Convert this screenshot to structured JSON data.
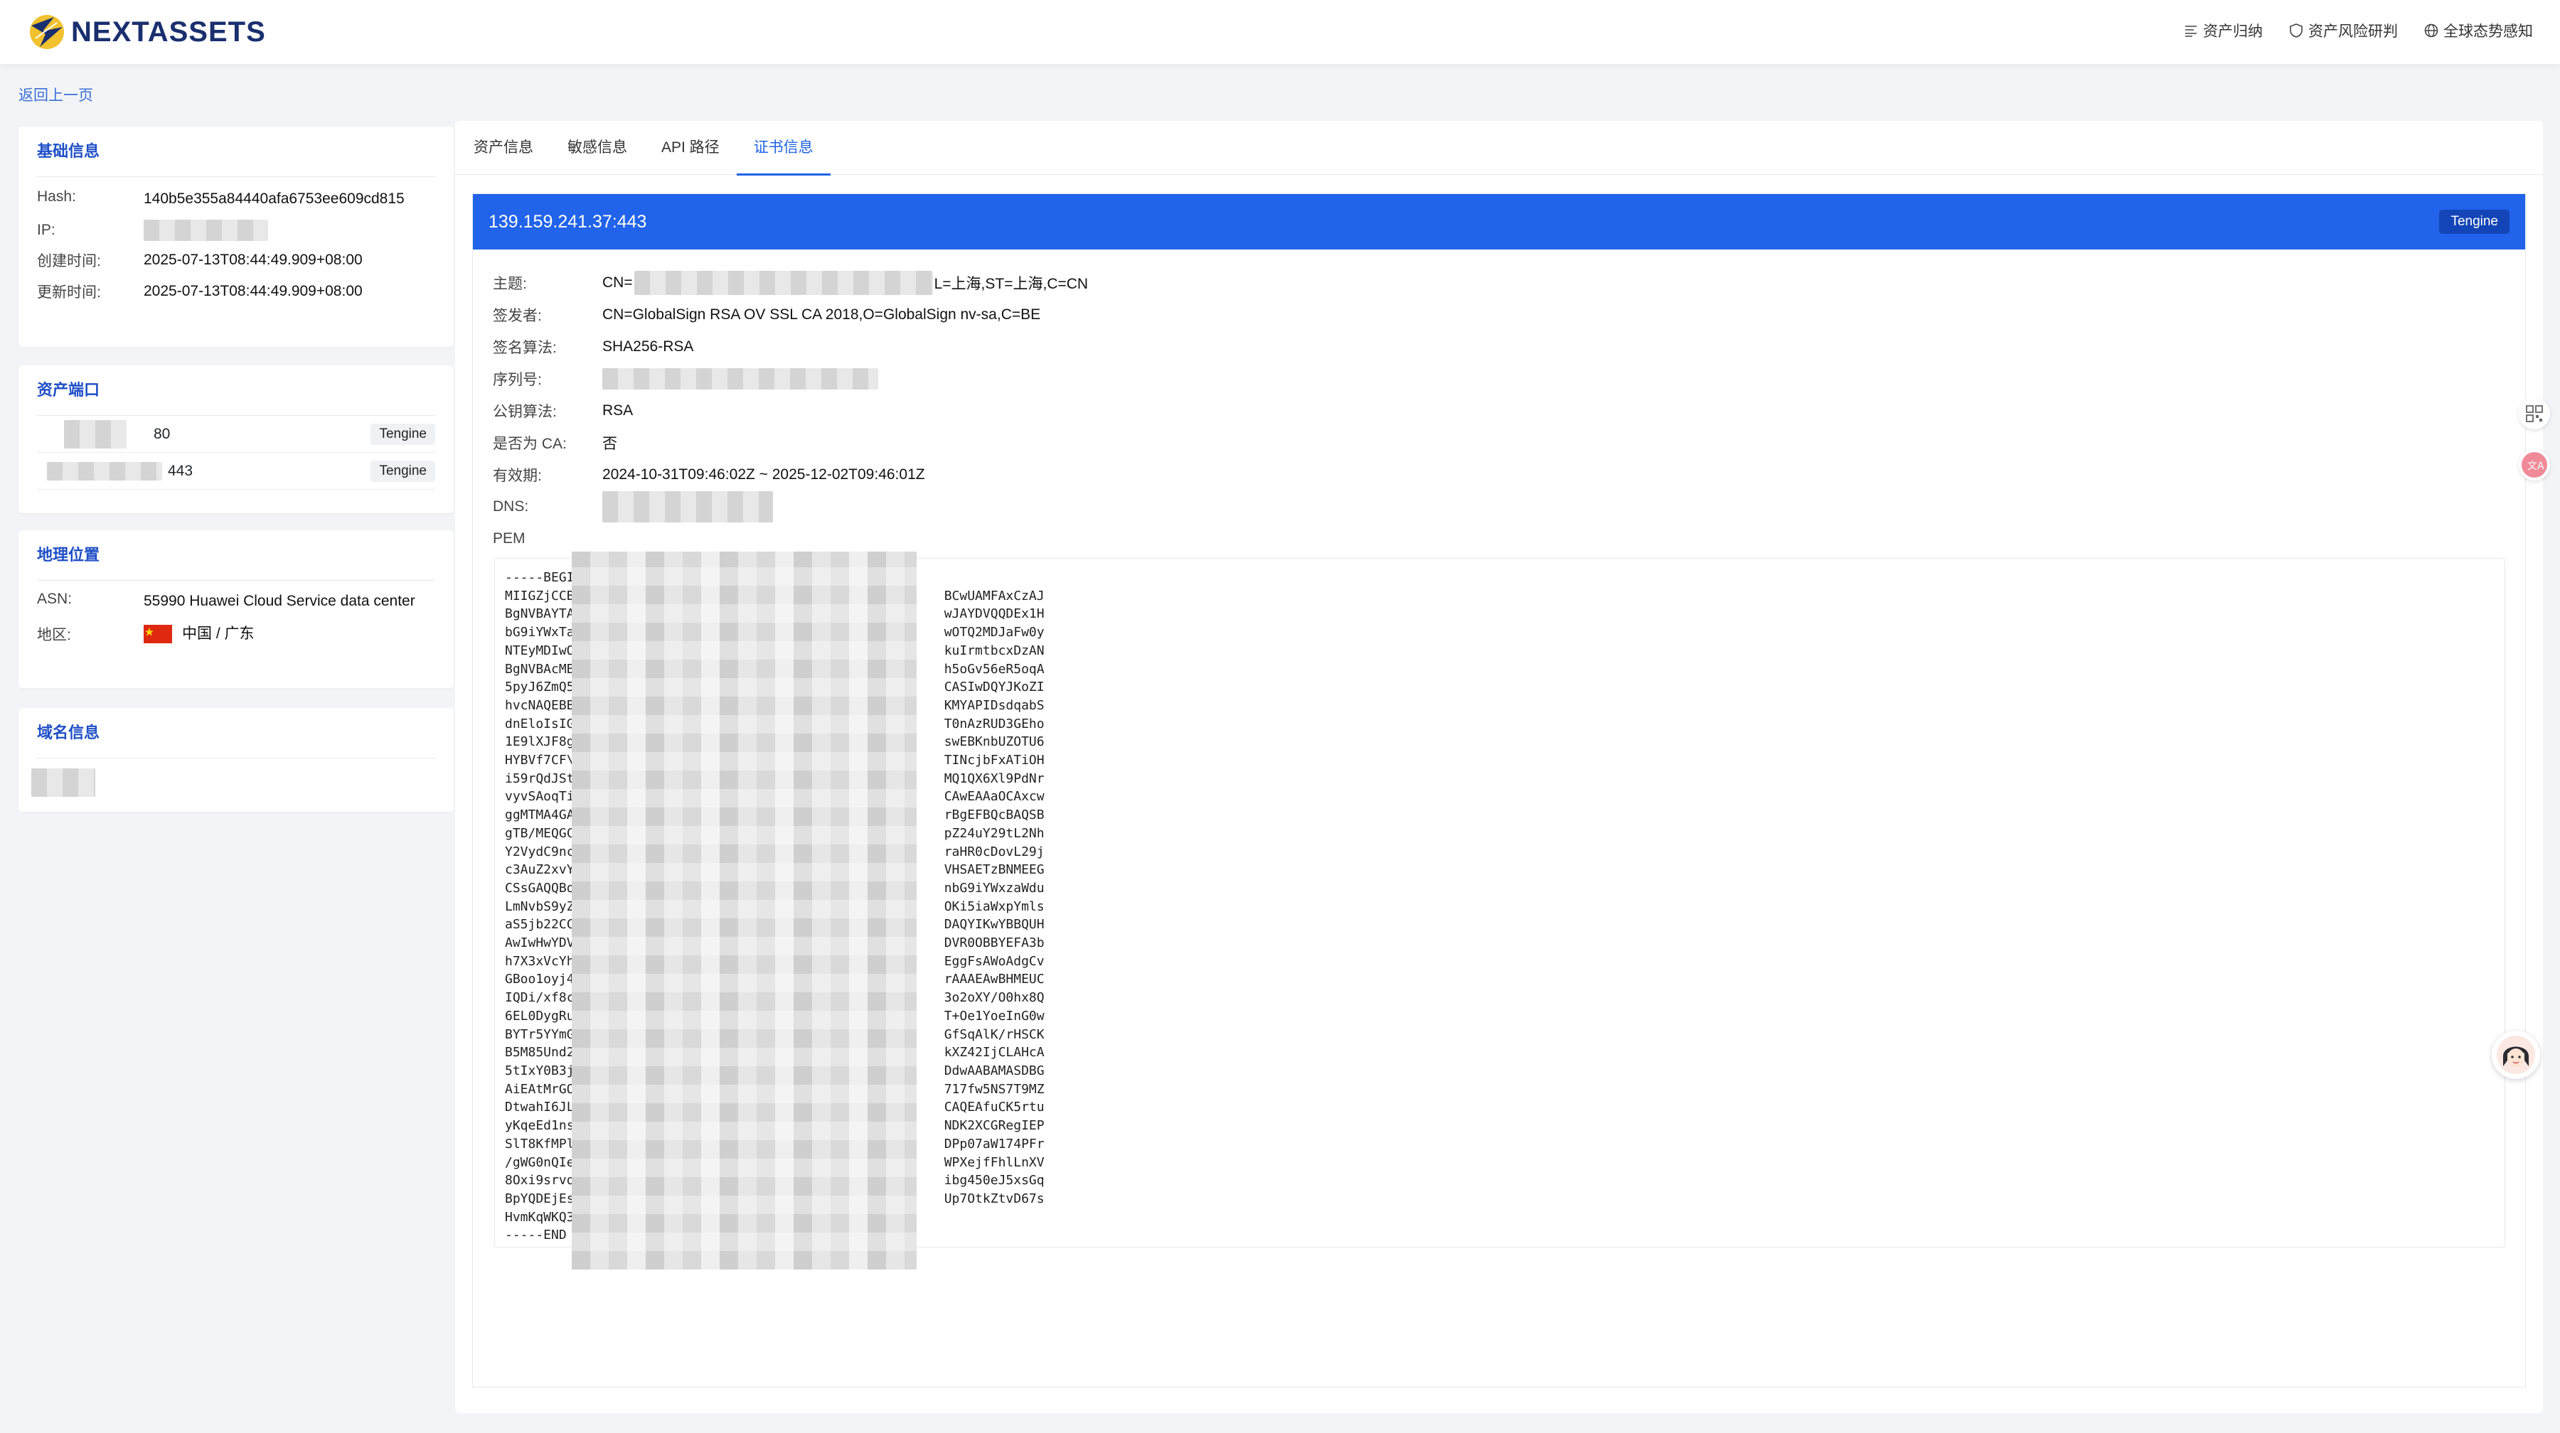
{
  "app": {
    "brand": "NEXTASSETS"
  },
  "nav": [
    {
      "label": "资产归纳",
      "icon": "list-icon"
    },
    {
      "label": "资产风险研判",
      "icon": "shield-icon"
    },
    {
      "label": "全球态势感知",
      "icon": "globe-icon"
    }
  ],
  "back_label": "返回上一页",
  "basic": {
    "title": "基础信息",
    "hash_label": "Hash:",
    "hash_value": "140b5e355a84440afa6753ee609cd815",
    "ip_label": "IP:",
    "created_label": "创建时间:",
    "created_value": "2025-07-13T08:44:49.909+08:00",
    "updated_label": "更新时间:",
    "updated_value": "2025-07-13T08:44:49.909+08:00"
  },
  "ports": {
    "title": "资产端口",
    "items": [
      {
        "port": "80",
        "server": "Tengine"
      },
      {
        "port": "443",
        "server": "Tengine"
      }
    ]
  },
  "geo": {
    "title": "地理位置",
    "asn_label": "ASN:",
    "asn_value": "55990 Huawei Cloud Service data center",
    "region_label": "地区:",
    "region_value": "中国 / 广东"
  },
  "domain": {
    "title": "域名信息"
  },
  "tabs": [
    {
      "label": "资产信息"
    },
    {
      "label": "敏感信息"
    },
    {
      "label": "API 路径"
    },
    {
      "label": "证书信息",
      "active": true
    }
  ],
  "cert": {
    "host": "139.159.241.37:443",
    "server_badge": "Tengine",
    "subject_label": "主题:",
    "subject_prefix": "CN=",
    "subject_suffix": "L=上海,ST=上海,C=CN",
    "issuer_label": "签发者:",
    "issuer_value": "CN=GlobalSign RSA OV SSL CA 2018,O=GlobalSign nv-sa,C=BE",
    "sig_label": "签名算法:",
    "sig_value": "SHA256-RSA",
    "serial_label": "序列号:",
    "pubkey_label": "公钥算法:",
    "pubkey_value": "RSA",
    "ca_label": "是否为 CA:",
    "ca_value": "否",
    "validity_label": "有效期:",
    "validity_value": "2024-10-31T09:46:02Z ~ 2025-12-02T09:46:01Z",
    "dns_label": "DNS:",
    "pem_label": "PEM",
    "pem_text": "-----BEGI\nMIIGZjCCB                                                BCwUAMFAxCzAJ\nBgNVBAYTA                                                wJAYDVQQDEx1H\nbG9iYWxTa                                                wOTQ2MDJaFw0y\nNTEyMDIwO                                                kuIrmtbcxDzAN\nBgNVBAcMB                                                h5oGv56eR5oqA\n5pyJ6ZmQ5                                                CASIwDQYJKoZI\nhvcNAQEBB                                                KMYAPIDsdqabS\ndnEloIsIG                                                T0nAzRUD3GEho\n1E9lXJF8g                                                swEBKnbUZOTU6\nHYBVf7CF\\                                                TINcjbFxATiOH\ni59rQdJSt                                                MQ1QX6Xl9PdNr\nvyvSAoqTi                                                CAwEAAaOCAxcw\nggMTMA4GA                                                rBgEFBQcBAQSB\ngTB/MEQGC                                                pZ24uY29tL2Nh\nY2VydC9nc                                                raHR0cDovL29j\nc3AuZ2xvY                                                VHSAETzBNMEEG\nCSsGAQQBo                                                nbG9iYWxzaWdu\nLmNvbS9yZ                                                OKi5iaWxpYmls\naS5jb22CC                                                DAQYIKwYBBQUH\nAwIwHwYDV                                                DVR0OBBYEFA3b\nh7X3xVcYh                                                EggFsAWoAdgCv\nGBoo1oyj4                                                rAAAEAwBHMEUC\nIQDi/xf8c                                                3o2oXY/O0hx8Q\n6EL0DygRu                                                T+Oe1YoeInG0w\nBYTr5YYmG                                                GfSqAlK/rHSCK\nB5M85Und2                                                kXZ42IjCLAHcA\n5tIxY0B3j                                                DdwAABAMASDBG\nAiEAtMrGO                                                717fw5NS7T9MZ\nDtwahI6JL                                                CAQEAfuCK5rtu\nyKqeEd1ns                                                NDK2XCGRegIEP\nSlT8KfMPl                                                DPp07aW174PFr\n/gWG0nQIe                                                WPXejfFhlLnXV\n8Oxi9srvo                                                ibg450eJ5xsGq\nBpYQDEjEs                                                Up7OtkZtvD67s\nHvmKqWKQ3\n-----END "
  }
}
